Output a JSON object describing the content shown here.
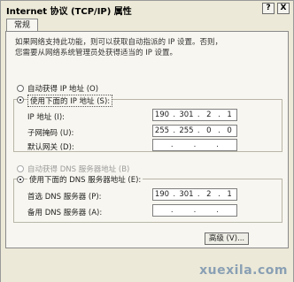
{
  "window": {
    "title": "Internet 协议 (TCP/IP) 属性",
    "help_label": "?",
    "close_label": "X"
  },
  "tabs": [
    "常规"
  ],
  "description": [
    "如果网络支持此功能，则可以获取自动指派的 IP 设置。否则，",
    "您需要从网络系统管理员处获得适当的 IP 设置。"
  ],
  "ip_section": {
    "auto_label": "自动获得 IP 地址 (O)",
    "manual_label": "使用下面的 IP 地址 (S):",
    "selected": "manual",
    "fields": [
      {
        "label": "IP 地址 (I):",
        "value": [
          "190",
          "301",
          "2",
          "1"
        ]
      },
      {
        "label": "子网掩码 (U):",
        "value": [
          "255",
          "255",
          "0",
          "0"
        ]
      },
      {
        "label": "默认网关 (D):",
        "value": [
          "",
          "",
          "",
          ""
        ]
      }
    ]
  },
  "dns_section": {
    "auto_label": "自动获得 DNS 服务器地址 (B)",
    "manual_label": "使用下面的 DNS 服务器地址 (E):",
    "selected": "manual",
    "fields": [
      {
        "label": "首选 DNS 服务器 (P):",
        "value": [
          "190",
          "301",
          "2",
          "1"
        ]
      },
      {
        "label": "备用 DNS 服务器 (A):",
        "value": [
          "",
          "",
          "",
          ""
        ]
      }
    ]
  },
  "advanced_button": "高级 (V)...",
  "watermark": "xuexila.com"
}
